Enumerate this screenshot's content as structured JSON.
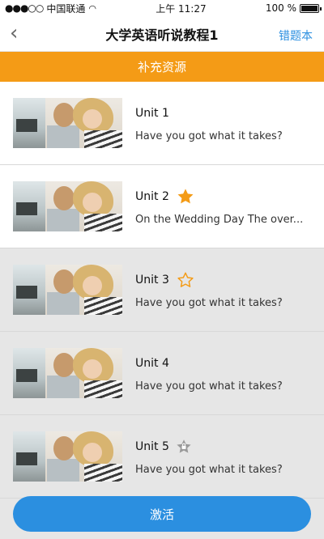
{
  "status": {
    "carrier": "中国联通",
    "time": "上午 11:27",
    "battery": "100 %"
  },
  "nav": {
    "back_icon": "chevron-left-icon",
    "title": "大学英语听说教程1",
    "right_label": "错题本"
  },
  "banner": {
    "label": "补充资源"
  },
  "units": [
    {
      "title": "Unit 1",
      "subtitle": "Have you got what it takes?",
      "star": "none"
    },
    {
      "title": "Unit 2",
      "subtitle": "On the Wedding Day The over...",
      "star": "filled"
    },
    {
      "title": "Unit 3",
      "subtitle": "Have you got what it takes?",
      "star": "outline"
    },
    {
      "title": "Unit 4",
      "subtitle": "Have you got what it takes?",
      "star": "none"
    },
    {
      "title": "Unit 5",
      "subtitle": "Have you got what it takes?",
      "star": "locked"
    }
  ],
  "bottom_button": {
    "label": "激活"
  },
  "colors": {
    "accent_orange": "#f49b16",
    "link_blue": "#2b8fe0"
  }
}
